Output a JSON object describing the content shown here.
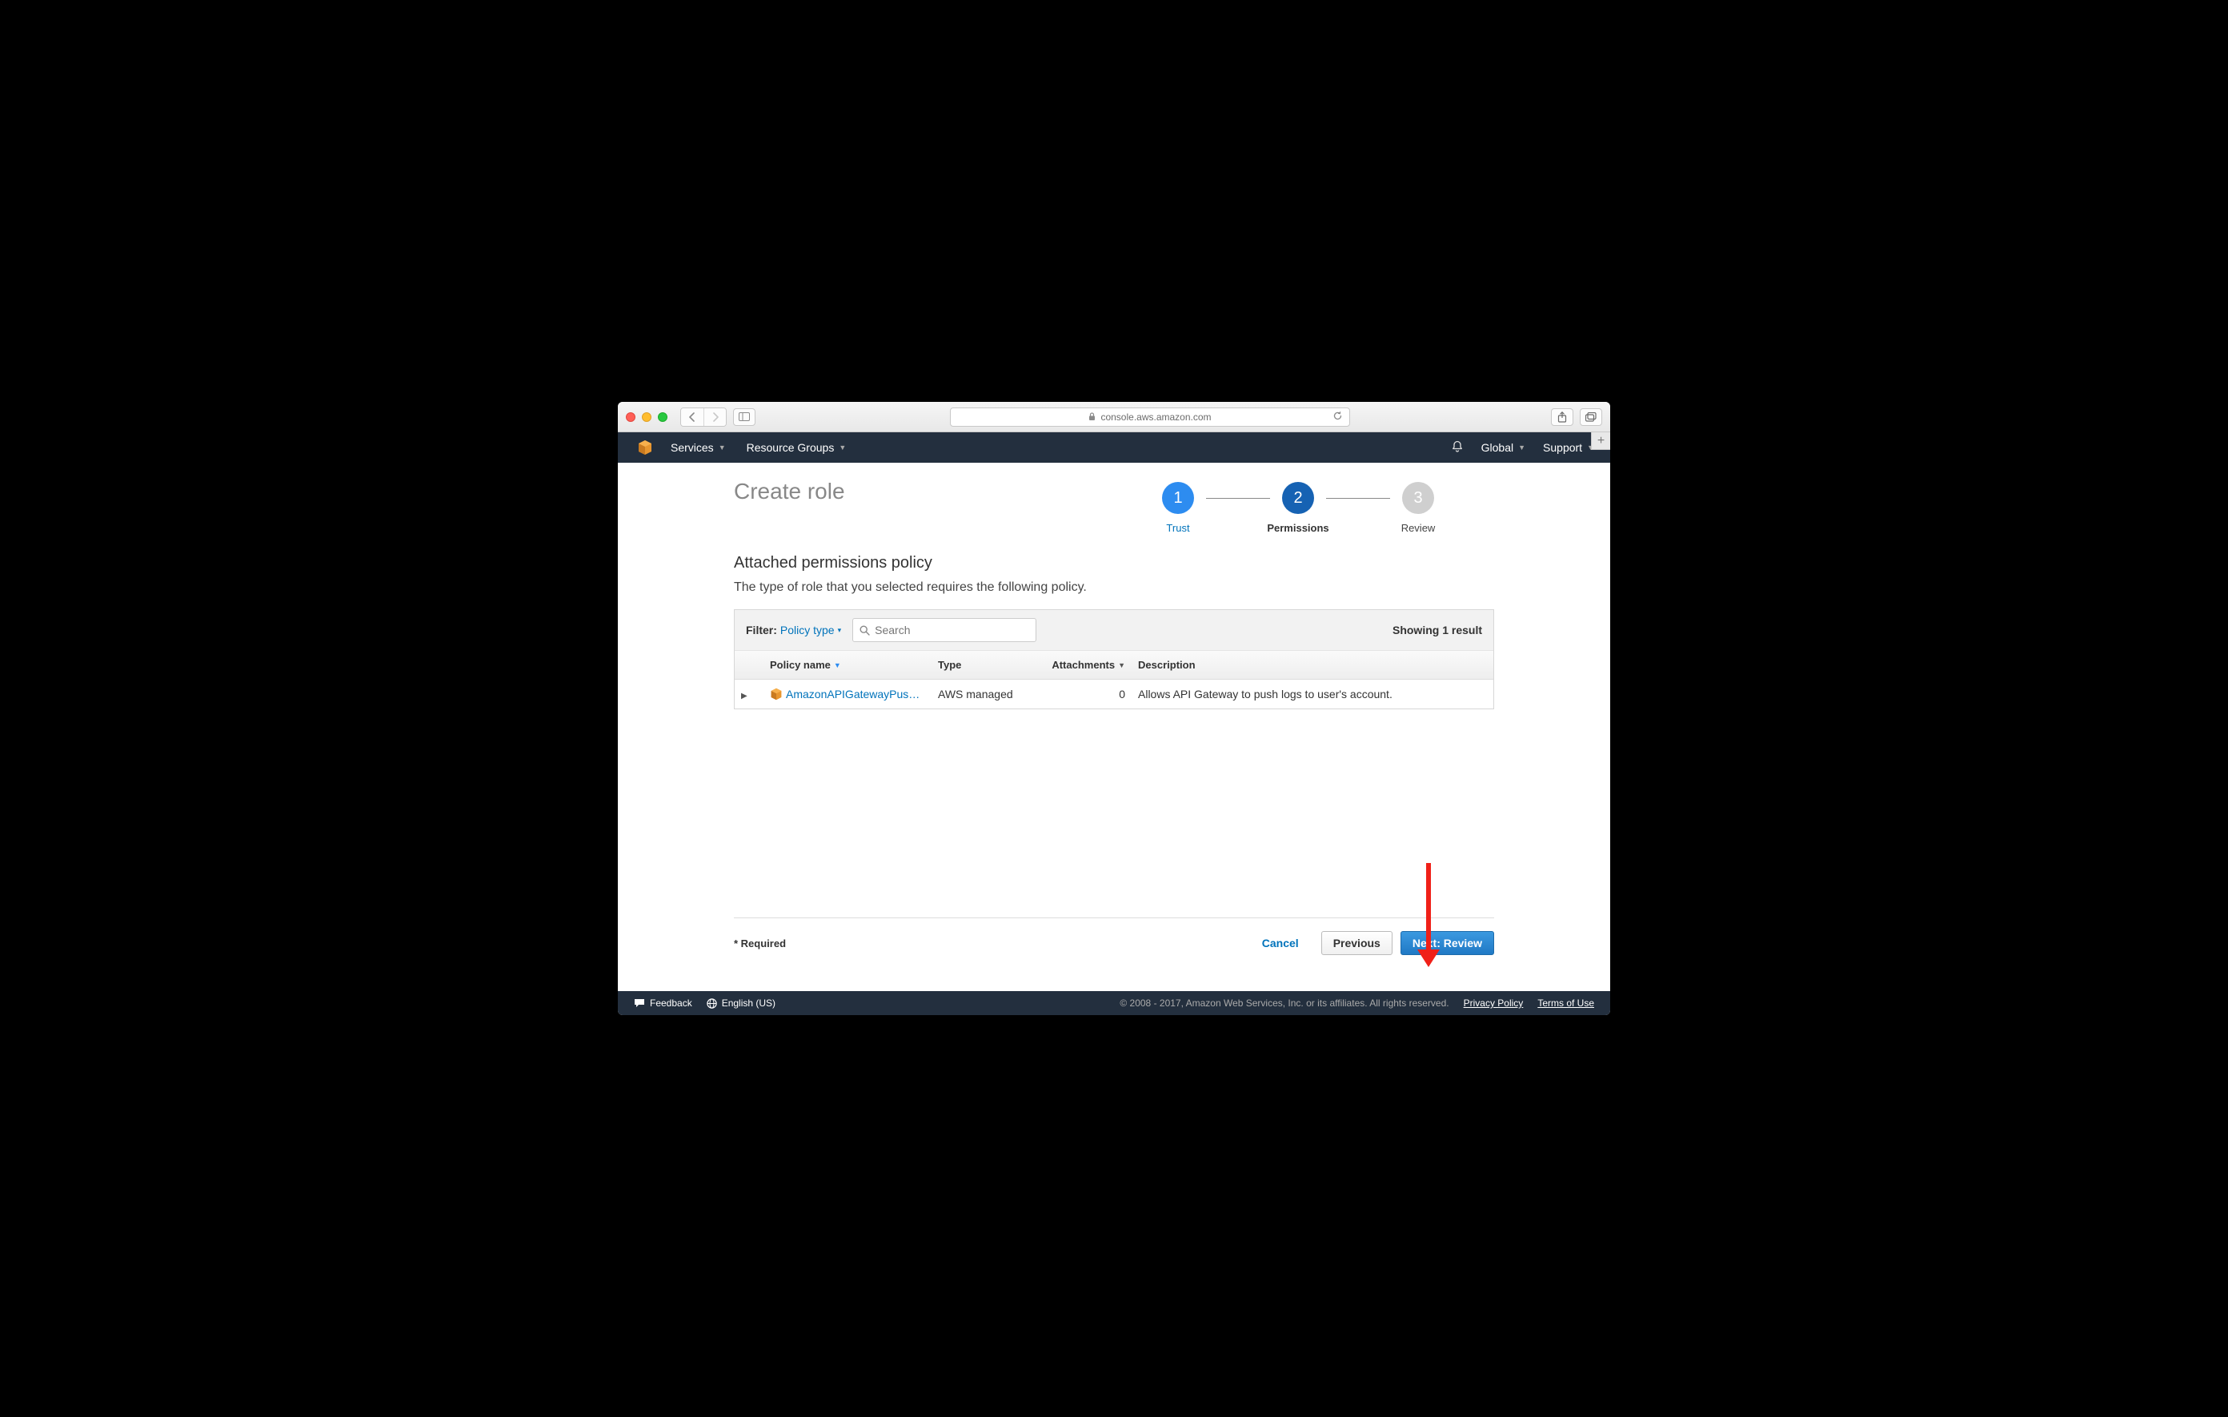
{
  "browser": {
    "url_host": "console.aws.amazon.com"
  },
  "header": {
    "services": "Services",
    "resource_groups": "Resource Groups",
    "global": "Global",
    "support": "Support"
  },
  "page": {
    "title": "Create role",
    "section_title": "Attached permissions policy",
    "section_desc": "The type of role that you selected requires the following policy."
  },
  "wizard": {
    "step1": {
      "num": "1",
      "label": "Trust"
    },
    "step2": {
      "num": "2",
      "label": "Permissions"
    },
    "step3": {
      "num": "3",
      "label": "Review"
    }
  },
  "filter": {
    "label": "Filter:",
    "policy_type": "Policy type",
    "search_placeholder": "Search",
    "result_count": "Showing 1 result"
  },
  "columns": {
    "name": "Policy name",
    "type": "Type",
    "attachments": "Attachments",
    "description": "Description"
  },
  "row": {
    "name": "AmazonAPIGatewayPush…",
    "type": "AWS managed",
    "attachments": "0",
    "description": "Allows API Gateway to push logs to user's account."
  },
  "actions": {
    "required": "* Required",
    "cancel": "Cancel",
    "previous": "Previous",
    "next": "Next: Review"
  },
  "footer": {
    "feedback": "Feedback",
    "language": "English (US)",
    "copyright": "© 2008 - 2017, Amazon Web Services, Inc. or its affiliates. All rights reserved.",
    "privacy": "Privacy Policy",
    "terms": "Terms of Use"
  }
}
